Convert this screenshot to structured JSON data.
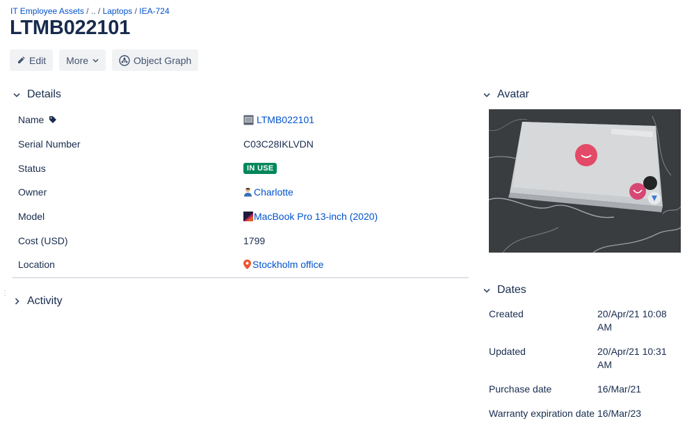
{
  "breadcrumb": {
    "items": [
      "IT Employee Assets",
      "..",
      "Laptops",
      "IEA-724"
    ],
    "separator": "/"
  },
  "page_title": "LTMB022101",
  "toolbar": {
    "edit_label": "Edit",
    "more_label": "More",
    "object_graph_label": "Object Graph"
  },
  "details": {
    "heading": "Details",
    "rows": [
      {
        "label": "Name",
        "value": "LTMB022101",
        "type": "link",
        "icon": "laptop-thumbnail-icon"
      },
      {
        "label": "Serial Number",
        "value": "C03C28IKLVDN",
        "type": "text"
      },
      {
        "label": "Status",
        "value": "IN USE",
        "type": "lozenge",
        "color": "#00875a"
      },
      {
        "label": "Owner",
        "value": "Charlotte",
        "type": "link",
        "icon": "user-icon"
      },
      {
        "label": "Model",
        "value": "MacBook Pro 13-inch (2020)",
        "type": "link",
        "icon": "model-thumbnail-icon"
      },
      {
        "label": "Cost (USD)",
        "value": "1799",
        "type": "text"
      },
      {
        "label": "Location",
        "value": "Stockholm office",
        "type": "link",
        "icon": "location-pin-icon"
      }
    ]
  },
  "activity": {
    "heading": "Activity"
  },
  "avatar": {
    "heading": "Avatar"
  },
  "dates": {
    "heading": "Dates",
    "rows": [
      {
        "label": "Created",
        "value": "20/Apr/21 10:08 AM"
      },
      {
        "label": "Updated",
        "value": "20/Apr/21 10:31 AM"
      },
      {
        "label": "Purchase date",
        "value": "16/Mar/21"
      },
      {
        "label": "Warranty expiration date",
        "value": "16/Mar/23"
      }
    ]
  },
  "colors": {
    "link": "#0052cc",
    "text": "#172b4d",
    "status_green": "#00875a",
    "button_bg": "#f1f2f4"
  }
}
